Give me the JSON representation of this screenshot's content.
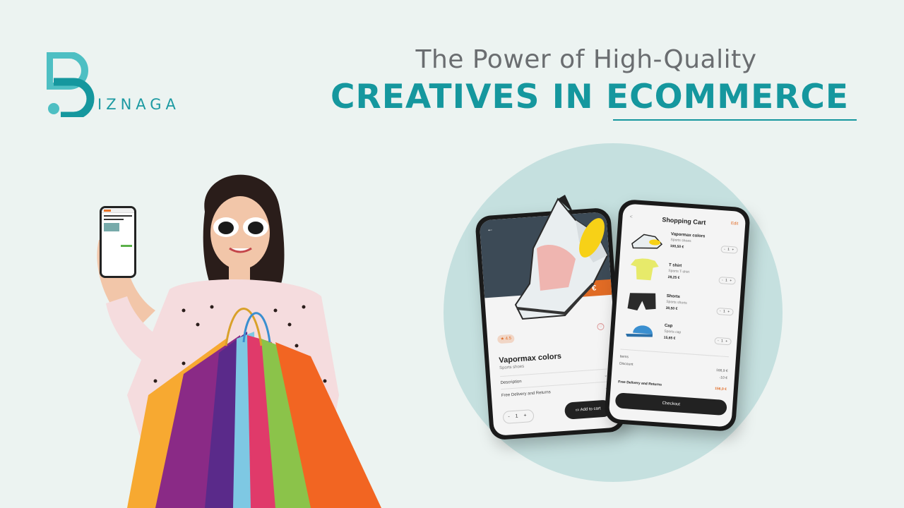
{
  "brand": {
    "logo_letter": "B",
    "logo_rest": "IZNAGA",
    "primary_color": "#15979e",
    "accent_color": "#e06b25"
  },
  "headline": {
    "line1": "The Power of High-Quality",
    "line2": "CREATIVES IN ECOMMERCE"
  },
  "product_phone": {
    "price": "0,50 €",
    "rating": "4.5",
    "product_name": "Vapormax colors",
    "product_sub": "Sports shoes",
    "rows": [
      "Description",
      "Free Delivery and Returns"
    ],
    "quantity": "- 1 +",
    "cart_button": "Add to cart"
  },
  "cart_phone": {
    "title": "Shopping Cart",
    "back": "<",
    "edit": "Edit",
    "items": [
      {
        "name": "Vapormax colors",
        "sub": "Sports shoes",
        "price": "100,50 €",
        "qty": "- 1 +"
      },
      {
        "name": "T shirt",
        "sub": "Sports T-shirt",
        "price": "28,25 €",
        "qty": "- 1 +"
      },
      {
        "name": "Shorts",
        "sub": "Sports shorts",
        "price": "30,50 €",
        "qty": "- 1 +"
      },
      {
        "name": "Cap",
        "sub": "Sports cap",
        "price": "15,65 €",
        "qty": "- 1 +"
      }
    ],
    "summary": [
      {
        "label": "Items",
        "value": ""
      },
      {
        "label": "Discount",
        "value": "166,9 €"
      },
      {
        "label": "",
        "value": "-10 €"
      }
    ],
    "free_delivery": {
      "label": "Free Delivery and Returns",
      "value": "156,9 €"
    },
    "checkout_button": "Checkout"
  },
  "icons": {
    "back": "arrow-left-icon",
    "favorite": "heart-icon",
    "cart": "card-icon",
    "star": "star-icon"
  }
}
